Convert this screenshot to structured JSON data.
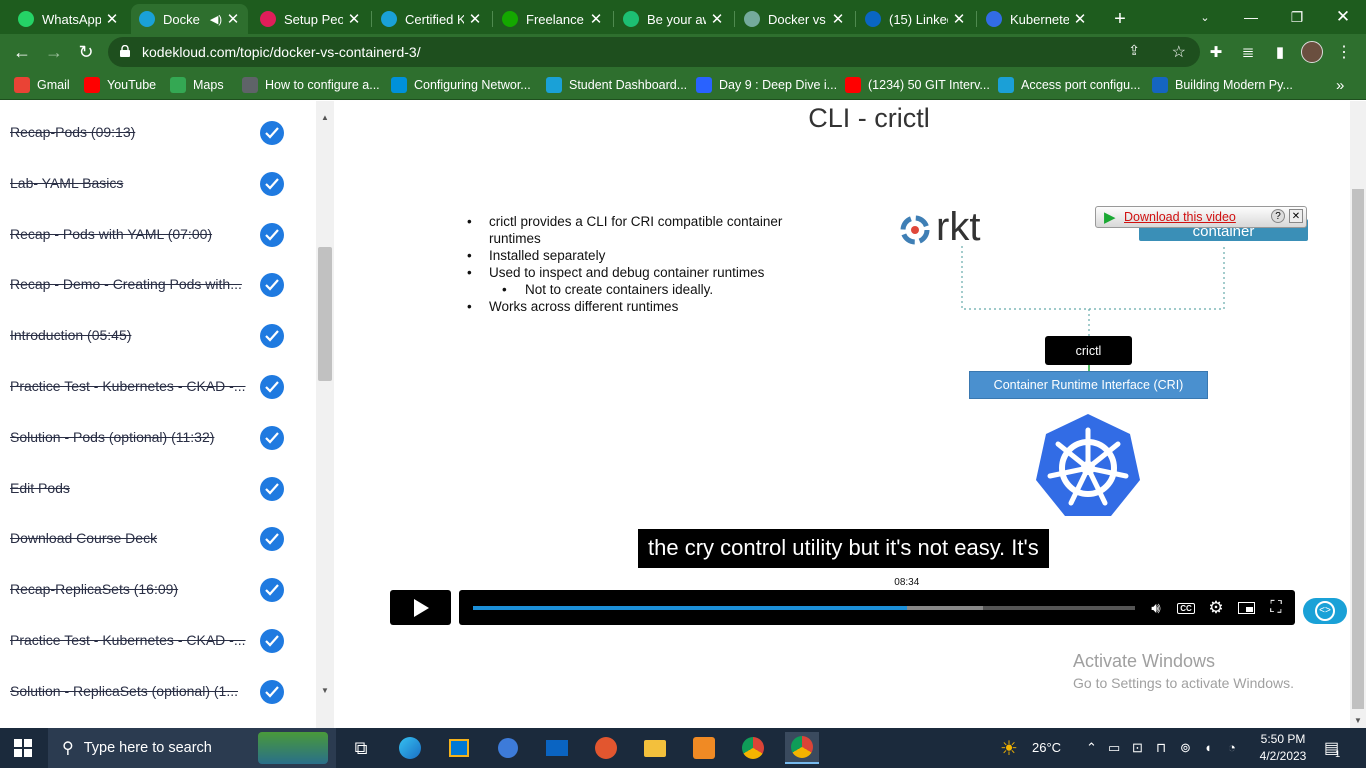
{
  "browser": {
    "tabs": [
      {
        "label": "WhatsApp",
        "icon": "whatsapp-icon",
        "color": "#25d366"
      },
      {
        "label": "Docke",
        "icon": "kodekloud-icon",
        "color": "#1aa1d7",
        "active": true,
        "audio": true
      },
      {
        "label": "Setup Peop",
        "icon": "slack-icon",
        "color": "#e01e5a"
      },
      {
        "label": "Certified K",
        "icon": "kodekloud-icon",
        "color": "#1aa1d7"
      },
      {
        "label": "Freelance",
        "icon": "upwork-icon",
        "color": "#14a800"
      },
      {
        "label": "Be your aw",
        "icon": "fiverr-icon",
        "color": "#1dbf73"
      },
      {
        "label": "Docker vs",
        "icon": "chatgpt-icon",
        "color": "#74aa9c"
      },
      {
        "label": "(15) Linked",
        "icon": "linkedin-icon",
        "color": "#0a66c2"
      },
      {
        "label": "Kubernete",
        "icon": "kubernetes-icon",
        "color": "#326ce5"
      }
    ],
    "url": "kodekloud.com/topic/docker-vs-containerd-3/",
    "bookmarks": [
      {
        "label": "Gmail",
        "icon": "gmail-icon",
        "color": "#ea4335"
      },
      {
        "label": "YouTube",
        "icon": "youtube-icon",
        "color": "#ff0000"
      },
      {
        "label": "Maps",
        "icon": "maps-icon",
        "color": "#34a853"
      },
      {
        "label": "How to configure a...",
        "icon": "page-icon",
        "color": "#5f6368"
      },
      {
        "label": "Configuring Networ...",
        "icon": "vmware-icon",
        "color": "#0091da"
      },
      {
        "label": "Student Dashboard...",
        "icon": "kodekloud-icon",
        "color": "#1aa1d7"
      },
      {
        "label": "Day 9 : Deep Dive i...",
        "icon": "hashnode-icon",
        "color": "#2962ff"
      },
      {
        "label": "(1234) 50 GIT Interv...",
        "icon": "youtube-icon",
        "color": "#ff0000"
      },
      {
        "label": "Access port configu...",
        "icon": "cisco-icon",
        "color": "#1ba0d7"
      },
      {
        "label": "Building Modern Py...",
        "icon": "c-icon",
        "color": "#1565c0"
      }
    ]
  },
  "sidebar": {
    "lessons": [
      "Recap-Pods (09:13)",
      "Lab- YAML Basics",
      "Recap - Pods with YAML (07:00)",
      "Recap - Demo - Creating Pods with...",
      "Introduction (05:45)",
      "Practice Test - Kubernetes - CKAD -...",
      "Solution - Pods (optional) (11:32)",
      "Edit Pods",
      "Download Course Deck",
      "Recap-ReplicaSets (16:09)",
      "Practice Test - Kubernetes - CKAD -...",
      "Solution - ReplicaSets (optional) (1..."
    ]
  },
  "slide": {
    "title": "CLI - crictl",
    "bullets": [
      {
        "text": "crictl provides a CLI for CRI compatible container runtimes",
        "level": 0
      },
      {
        "text": "Installed separately",
        "level": 0
      },
      {
        "text": "Used to inspect and debug container runtimes",
        "level": 0
      },
      {
        "text": "Not to create containers ideally.",
        "level": 1
      },
      {
        "text": "Works across different runtimes",
        "level": 0
      }
    ],
    "rkt_label": "rkt",
    "containerd_label": "container",
    "download_link": "Download this video",
    "crictl_label": "crictl",
    "cri_label": "Container Runtime Interface (CRI)"
  },
  "video": {
    "caption": "the cry control utility but it's not easy. It's",
    "time_tooltip": "08:34",
    "progress": 0.656,
    "buffered": 0.77
  },
  "watermark": {
    "line1": "Activate Windows",
    "line2": "Go to Settings to activate Windows."
  },
  "taskbar": {
    "search_placeholder": "Type here to search",
    "temperature": "26°C",
    "time": "5:50 PM",
    "date": "4/2/2023",
    "notifications": "1"
  }
}
